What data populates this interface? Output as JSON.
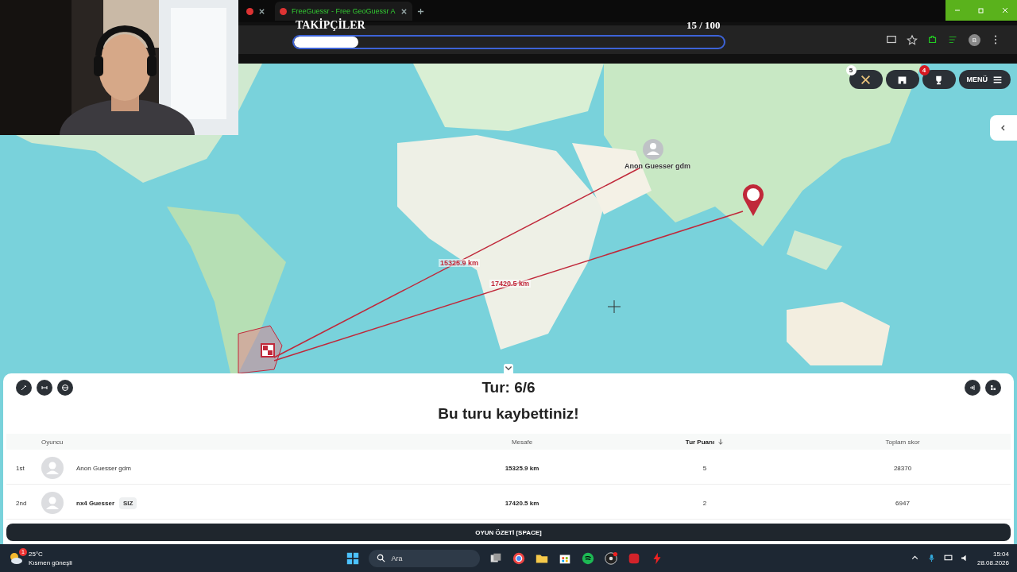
{
  "browser": {
    "tabs": [
      {
        "selected": false
      },
      {
        "label": "FreeGuessr - Free GeoGuessr A",
        "selected": true
      }
    ],
    "profile": "B"
  },
  "stream_overlay": {
    "title": "TAKİPÇİLER",
    "count": "15 / 100",
    "level": 0.15
  },
  "map": {
    "buttons": [
      {
        "kind": "battle",
        "badge": "5"
      },
      {
        "kind": "store"
      },
      {
        "kind": "trophy",
        "badge": "4"
      },
      {
        "kind": "menu",
        "label": "MENÜ"
      }
    ],
    "opponent_label": "Anon Guesser gdm",
    "distances": [
      "15325.9 km",
      "17420.5 km"
    ]
  },
  "results": {
    "round": "Tur: 6/6",
    "message": "Bu turu kaybettiniz!",
    "columns": [
      "Oyuncu",
      "Mesafe",
      "Tur Puanı",
      "Toplam skor"
    ],
    "rows": [
      {
        "rank": "1st",
        "name": "Anon Guesser gdm",
        "distance": "15325.9 km",
        "points": "5",
        "total": "28370"
      },
      {
        "rank": "2nd",
        "name": "nx4 Guesser",
        "tag": "SIZ",
        "distance": "17420.5 km",
        "points": "2",
        "total": "6947"
      }
    ],
    "summary_button": {
      "label": "OYUN ÖZETİ",
      "key": "[SPACE]"
    }
  },
  "taskbar": {
    "temperature": "25°C",
    "weather": "Kısmen güneşli",
    "weather_badge": "1",
    "search": "Ara",
    "time": "15:04",
    "date": "28.08.2026"
  }
}
